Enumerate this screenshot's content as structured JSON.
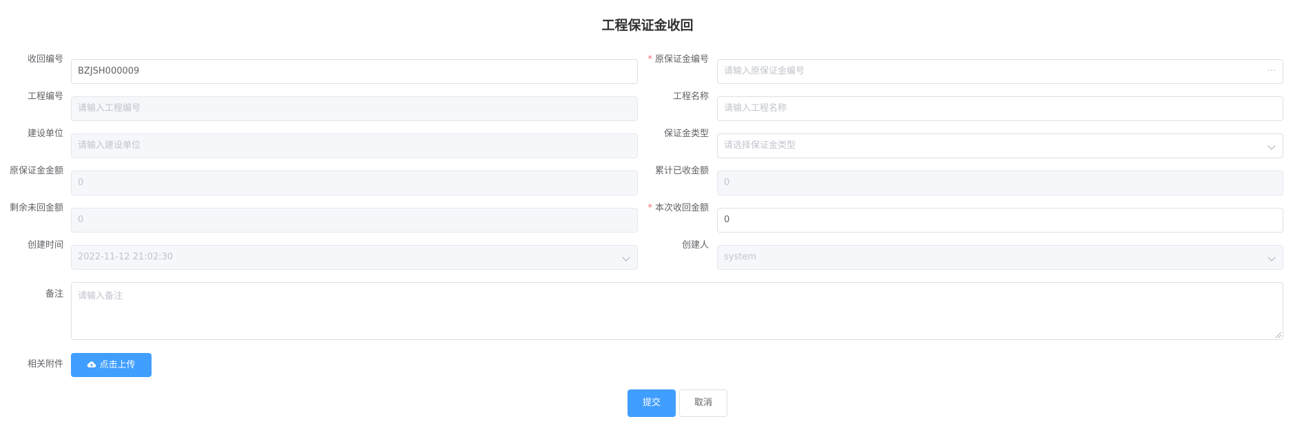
{
  "page": {
    "title": "工程保证金收回"
  },
  "form": {
    "recover_no": {
      "label": "收回编号",
      "value": "BZJSH000009"
    },
    "orig_deposit_no": {
      "label": "原保证金编号",
      "placeholder": "请输入原保证金编号",
      "suffix": "···"
    },
    "project_no": {
      "label": "工程编号",
      "placeholder": "请输入工程编号"
    },
    "project_name": {
      "label": "工程名称",
      "placeholder": "请输入工程名称"
    },
    "construction_unit": {
      "label": "建设单位",
      "placeholder": "请输入建设单位"
    },
    "deposit_type": {
      "label": "保证金类型",
      "placeholder": "请选择保证金类型"
    },
    "orig_amount": {
      "label": "原保证金金额",
      "value": "0"
    },
    "cumulative_recovered": {
      "label": "累计已收金额",
      "value": "0"
    },
    "remaining": {
      "label": "剩余未回金额",
      "value": "0"
    },
    "current_recover": {
      "label": "本次收回金额",
      "value": "0"
    },
    "created_time": {
      "label": "创建时间",
      "value": "2022-11-12 21:02:30"
    },
    "creator": {
      "label": "创建人",
      "value": "system"
    },
    "remark": {
      "label": "备注",
      "placeholder": "请输入备注"
    },
    "attachment": {
      "label": "相关附件",
      "upload_label": "点击上传"
    }
  },
  "actions": {
    "submit": "提交",
    "cancel": "取消"
  },
  "required_mark": "*",
  "colors": {
    "primary": "#409eff",
    "required": "#f56c6c",
    "disabled_bg": "#f5f7fa"
  }
}
